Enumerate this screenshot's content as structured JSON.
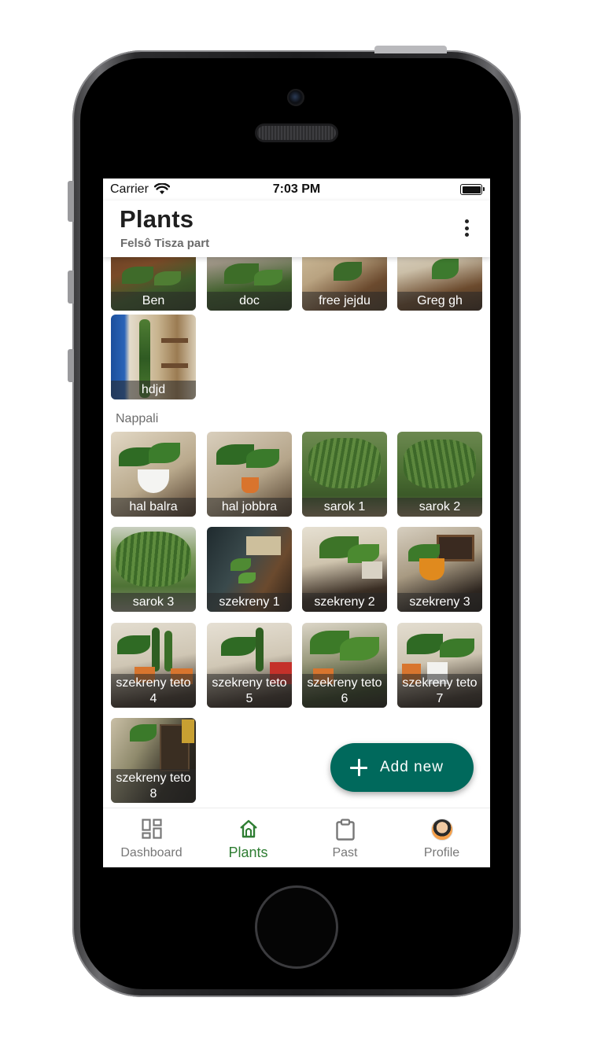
{
  "status_bar": {
    "carrier": "Carrier",
    "time": "7:03 PM"
  },
  "header": {
    "title": "Plants",
    "subtitle": "Felsô Tisza part"
  },
  "partial_section": {
    "plants": [
      {
        "name": "Ben"
      },
      {
        "name": "doc"
      },
      {
        "name": "free jejdu"
      },
      {
        "name": "Greg gh"
      },
      {
        "name": "hdjd"
      }
    ]
  },
  "section": {
    "title": "Nappali",
    "plants": [
      {
        "name": "hal balra"
      },
      {
        "name": "hal jobbra"
      },
      {
        "name": "sarok 1"
      },
      {
        "name": "sarok 2"
      },
      {
        "name": "sarok 3"
      },
      {
        "name": "szekreny 1"
      },
      {
        "name": "szekreny 2"
      },
      {
        "name": "szekreny 3"
      },
      {
        "name": "szekreny teto 4"
      },
      {
        "name": "szekreny teto 5"
      },
      {
        "name": "szekreny teto 6"
      },
      {
        "name": "szekreny teto 7"
      },
      {
        "name": "szekreny teto 8"
      }
    ]
  },
  "fab": {
    "label": "Add new"
  },
  "nav": {
    "items": [
      {
        "label": "Dashboard",
        "icon": "dashboard-icon"
      },
      {
        "label": "Plants",
        "icon": "home-icon",
        "active": true
      },
      {
        "label": "Past",
        "icon": "clipboard-icon"
      },
      {
        "label": "Profile",
        "icon": "avatar"
      }
    ]
  },
  "colors": {
    "accent": "#00695c",
    "active_nav": "#2e7d32"
  }
}
